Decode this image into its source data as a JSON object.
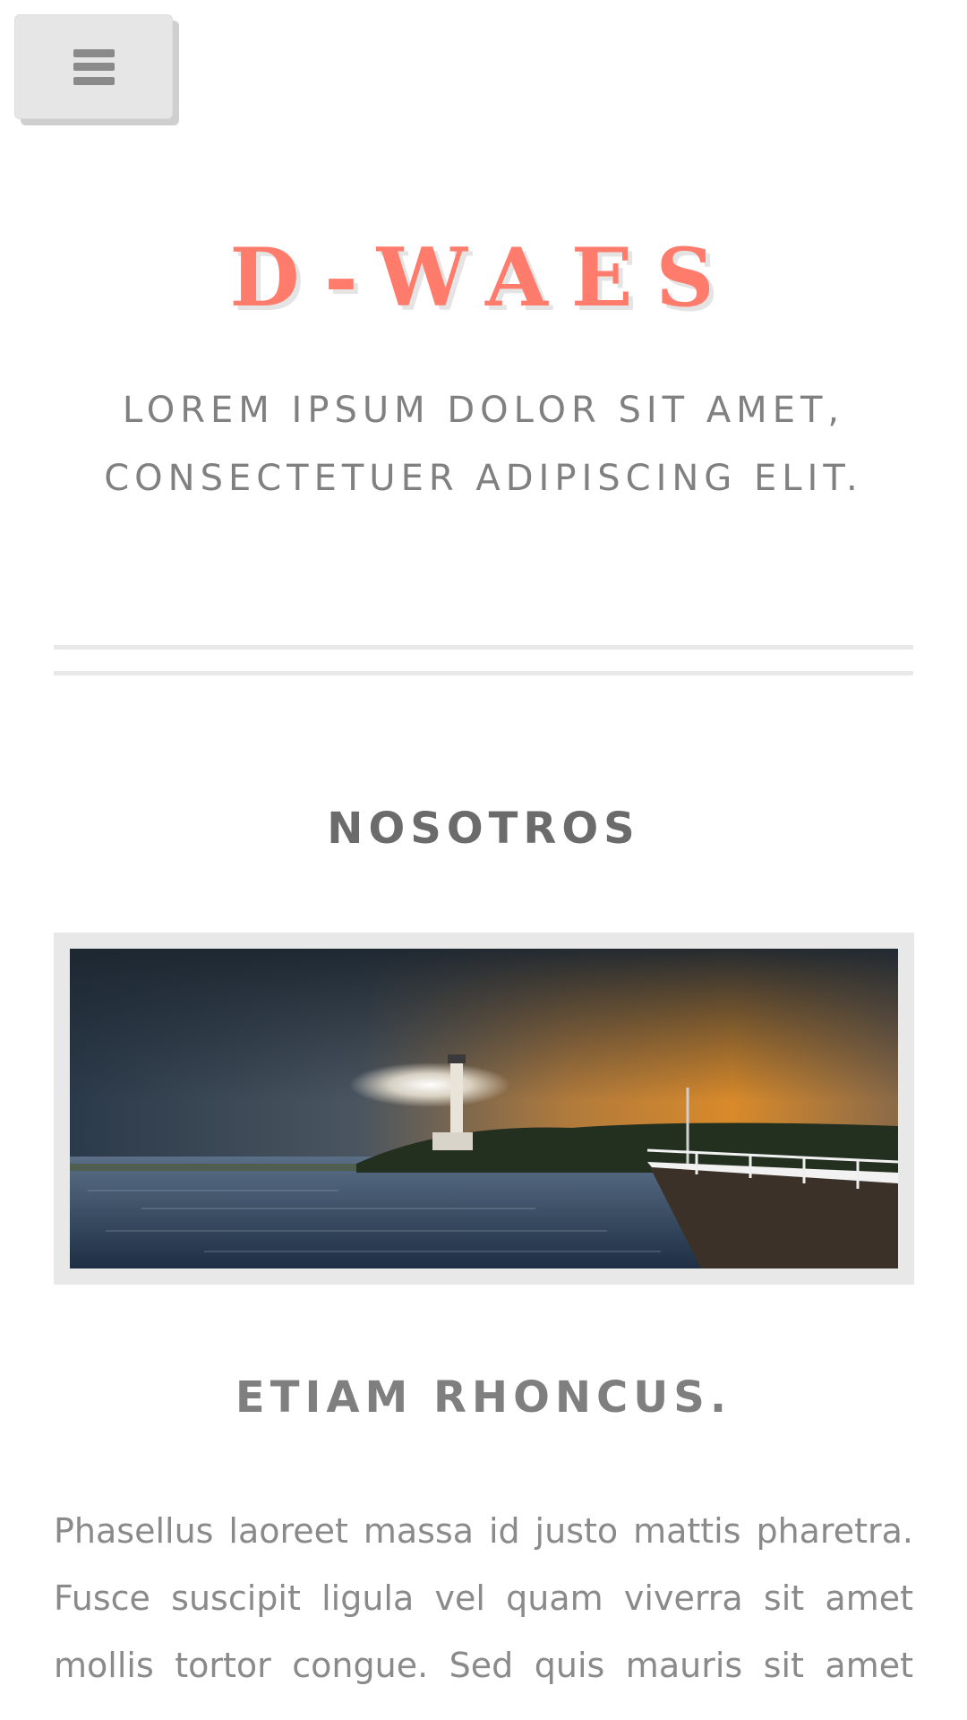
{
  "menu": {
    "icon": "hamburger-menu-icon"
  },
  "header": {
    "site_title": "D-WAES",
    "tagline": "LOREM IPSUM DOLOR SIT AMET, CONSECTETUER ADIPISCING ELIT."
  },
  "about": {
    "heading": "NOSOTROS",
    "image": "lighthouse-pier-sunset-photo",
    "subheading": "ETIAM RHONCUS.",
    "body": "Phasellus laoreet massa id justo mattis pharetra. Fusce suscipit ligula vel quam viverra sit amet mollis tortor congue. Sed quis mauris sit amet magna"
  },
  "colors": {
    "title": "#ff7b6b",
    "text": "#808080",
    "frame": "#e8e8e8",
    "button": "#e6e6e6"
  }
}
